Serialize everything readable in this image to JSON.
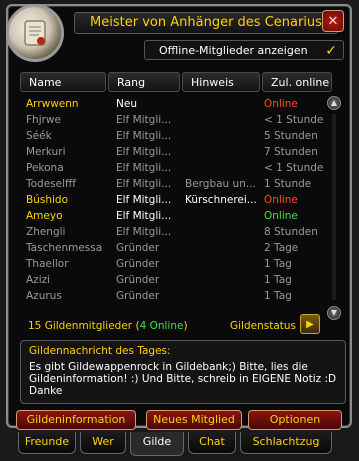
{
  "window": {
    "title": "Meister von Anhänger des Cenarius",
    "close_label": "✕"
  },
  "offline_toggle": {
    "label": "Offline-Mitglieder anzeigen",
    "checked": true,
    "check_mark": "✓"
  },
  "columns": [
    "Name",
    "Rang",
    "Hinweis",
    "Zul. online"
  ],
  "members": [
    {
      "name": "Arrwwenn",
      "rank": "Neu",
      "note": "",
      "online": "Online",
      "status": "online-self"
    },
    {
      "name": "Fhjrwe",
      "rank": "Elf Mitgli...",
      "note": "",
      "online": "< 1 Stunde",
      "status": "offline"
    },
    {
      "name": "Séék",
      "rank": "Elf Mitgli...",
      "note": "",
      "online": "5 Stunden",
      "status": "offline"
    },
    {
      "name": "Merkuri",
      "rank": "Elf Mitgli...",
      "note": "",
      "online": "7 Stunden",
      "status": "offline"
    },
    {
      "name": "Pekona",
      "rank": "Elf Mitgli...",
      "note": "",
      "online": "< 1 Stunde",
      "status": "offline"
    },
    {
      "name": "Todeselfff",
      "rank": "Elf Mitgli...",
      "note": "Bergbau un...",
      "online": "1 Stunde",
      "status": "offline"
    },
    {
      "name": "Búshido",
      "rank": "Elf Mitgli...",
      "note": "Kürschnerei...",
      "online": "Online",
      "status": "online-self"
    },
    {
      "name": "Ameyo",
      "rank": "Elf Mitgli...",
      "note": "",
      "online": "Online",
      "status": "online-green"
    },
    {
      "name": "Zhengli",
      "rank": "Elf Mitgli...",
      "note": "",
      "online": "8 Stunden",
      "status": "offline"
    },
    {
      "name": "Taschenmessa",
      "rank": "Gründer",
      "note": "",
      "online": "2 Tage",
      "status": "offline"
    },
    {
      "name": "Thaellor",
      "rank": "Gründer",
      "note": "",
      "online": "1 Tag",
      "status": "offline"
    },
    {
      "name": "Azizi",
      "rank": "Gründer",
      "note": "",
      "online": "1 Tag",
      "status": "offline"
    },
    {
      "name": "Azurus",
      "rank": "Gründer",
      "note": "",
      "online": "1 Tag",
      "status": "offline"
    }
  ],
  "footer": {
    "count_prefix": "15 Gildenmitglieder (",
    "online_count": "4 Online",
    "count_suffix": ")",
    "guild_status_label": "Gildenstatus",
    "guild_status_arrow": "▶"
  },
  "motd": {
    "title": "Gildennachricht des Tages:",
    "text": "Es gibt Gildewappenrock in Gildebank;) Bitte, lies die Gildeninformation! :) Und Bitte, schreib in EIGENE Notiz :D Danke"
  },
  "buttons": {
    "info": "Gildeninformation",
    "new_member": "Neues Mitglied",
    "options": "Optionen"
  },
  "tabs": [
    "Freunde",
    "Wer",
    "Gilde",
    "Chat",
    "Schlachtzug"
  ],
  "active_tab": "Gilde",
  "colors": {
    "gold": "#ffd200",
    "online_self": "#ff4a1f",
    "online_green": "#3fe03f",
    "offline": "#9a9a9a",
    "white": "#ffffff"
  }
}
